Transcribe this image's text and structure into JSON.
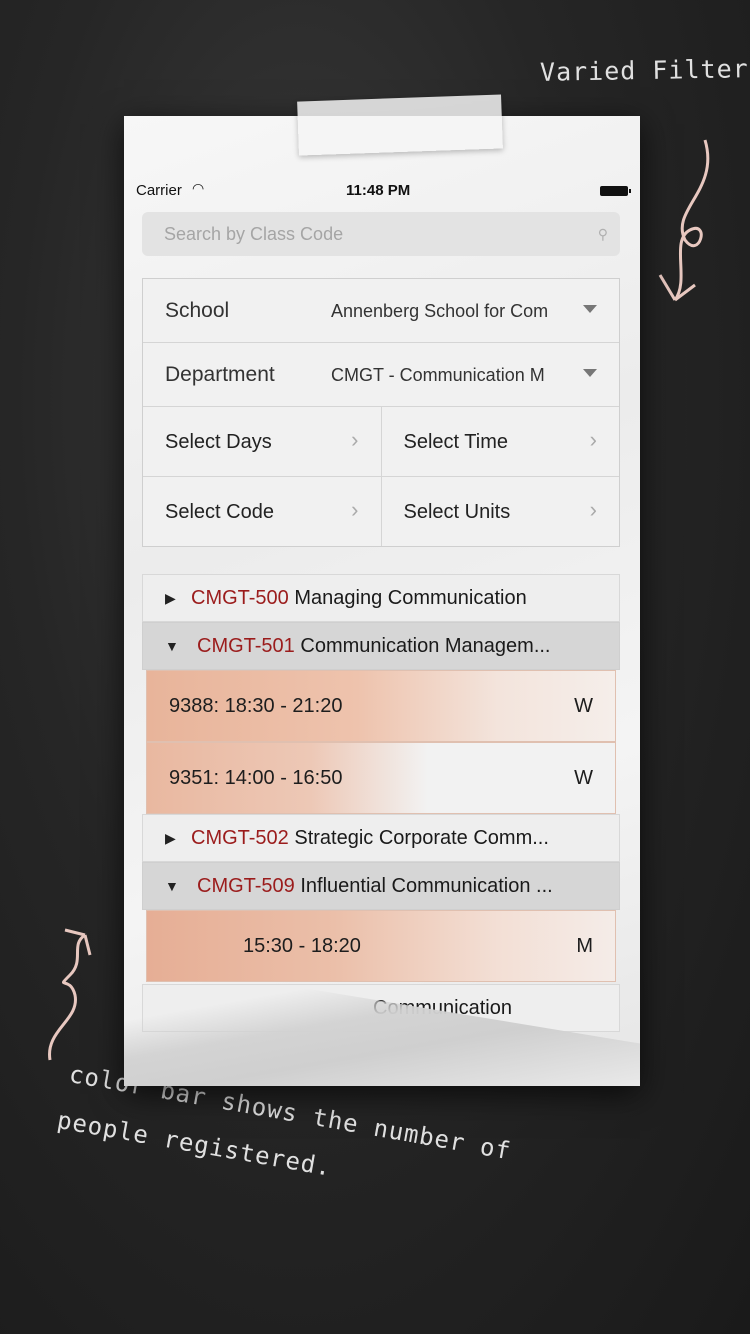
{
  "annotations": {
    "headline": "Varied Filter",
    "caption_line1": "color bar shows the number of",
    "caption_line2": "people registered."
  },
  "status_bar": {
    "carrier": "Carrier",
    "time": "11:48 PM"
  },
  "search": {
    "placeholder": "Search by Class Code"
  },
  "filters": {
    "school_label": "School",
    "school_value": "Annenberg School for Com",
    "department_label": "Department",
    "department_value": "CMGT - Communication M",
    "days_label": "Select Days",
    "time_label": "Select Time",
    "code_label": "Select Code",
    "units_label": "Select Units"
  },
  "courses": [
    {
      "code": "CMGT-500",
      "title": "Managing Communication",
      "expanded": false
    },
    {
      "code": "CMGT-501",
      "title": "Communication Managem...",
      "expanded": true,
      "sections": [
        {
          "text": "9388: 18:30 - 21:20",
          "day": "W"
        },
        {
          "text": "9351: 14:00 - 16:50",
          "day": "W"
        }
      ]
    },
    {
      "code": "CMGT-502",
      "title": "Strategic Corporate Comm...",
      "expanded": false
    },
    {
      "code": "CMGT-509",
      "title": "Influential Communication ...",
      "expanded": true,
      "sections": [
        {
          "text": "15:30 - 18:20",
          "day": "M"
        }
      ]
    },
    {
      "code": "",
      "title": "Communication",
      "expanded": false
    }
  ],
  "colors": {
    "course_code": "#9b1c1c",
    "registration_bar": "#e8b49a",
    "chalkboard": "#262626"
  }
}
